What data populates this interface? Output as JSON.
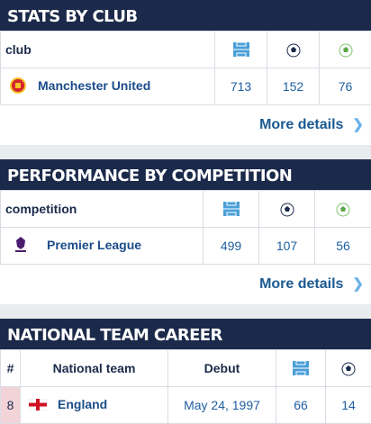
{
  "stats_by_club": {
    "title": "STATS BY CLUB",
    "column_label": "club",
    "icons": [
      "pitch-appearances-icon",
      "ball-goals-icon",
      "ball-assists-icon"
    ],
    "rows": [
      {
        "name": "Manchester United",
        "appearances": "713",
        "goals": "152",
        "assists": "76"
      }
    ],
    "more": "More details"
  },
  "performance": {
    "title": "PERFORMANCE BY COMPETITION",
    "column_label": "competition",
    "rows": [
      {
        "name": "Premier League",
        "appearances": "499",
        "goals": "107",
        "assists": "56"
      }
    ],
    "more": "More details"
  },
  "national": {
    "title": "NATIONAL TEAM CAREER",
    "col_rank": "#",
    "col_team": "National team",
    "col_debut": "Debut",
    "rows": [
      {
        "rank": "8",
        "team": "England",
        "debut": "May 24, 1997",
        "appearances": "66",
        "goals": "14"
      }
    ]
  },
  "colors": {
    "header_bg": "#1b2a4a",
    "link": "#1b4c8a",
    "value": "#1f5fa0",
    "chevron": "#6db3e8",
    "rank_bg": "#f2d4d8"
  }
}
